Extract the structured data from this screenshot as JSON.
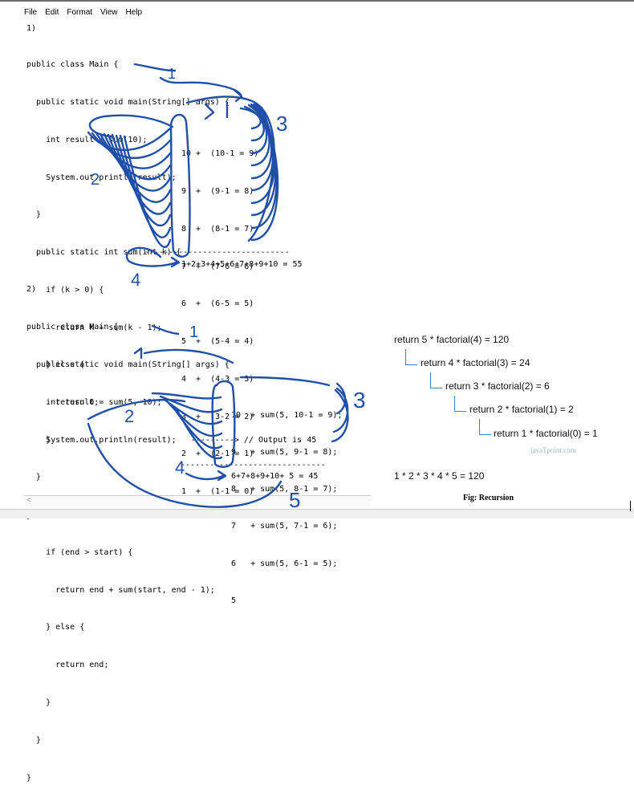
{
  "menu": [
    "File",
    "Edit",
    "Format",
    "View",
    "Help"
  ],
  "example1": {
    "label": "1)",
    "code": [
      "public class Main {",
      "  public static void main(String[] args) {",
      "    int result = sum(10);",
      "    System.out.println(result);",
      "  }",
      "  public static int sum(int k) {",
      "    if (k > 0) {",
      "      return k + sum(k - 1);",
      "    } else {",
      "      return 0;",
      "    }",
      "",
      "}"
    ],
    "trace": [
      "10 +  (10-1 = 9)",
      "9  +  (9-1 = 8)",
      "8  +  (8-1 = 7)",
      "7  +  (7-6 = 6)",
      "6  +  (6-5 = 5)",
      "5  +  (5-4 = 4)",
      "4  +  (4-3 = 3)",
      "3  +  (3-2 = 2)",
      "2  +  (2-1 = 1)",
      "1  +  (1-1 = 0)"
    ],
    "divider": "------------------------------",
    "result": "1+2+3+4+5+6+7+8+9+10 = 55",
    "annotations": [
      "1",
      "2",
      "3",
      "4"
    ]
  },
  "example2": {
    "label": "2)",
    "code": [
      "public class Main {",
      "  public static void main(String[] args) {",
      "    int result = sum(5, 10);",
      "    System.out.println(result);   ---------> // Output is 45",
      "  }",
      "  public static int sum(int start, int end) {",
      "    if (end > start) {",
      "      return end + sum(start, end - 1);",
      "    } else {",
      "      return end;",
      "    }",
      "  }",
      "}"
    ],
    "trace": [
      "10  + sum(5, 10-1 = 9);",
      "9   + sum(5, 9-1 = 8);",
      "8   + sum(5, 8-1 = 7);",
      "7   + sum(5, 7-1 = 6);",
      "6   + sum(5, 6-1 = 5);",
      "5"
    ],
    "divider": "------------------------------",
    "result": "6+7+8+9+10+ 5 = 45",
    "annotations": [
      "1",
      "2",
      "3",
      "4",
      "5"
    ]
  },
  "factorial": {
    "lines": [
      "return 5 * factorial(4) = 120",
      "return 4 * factorial(3) = 24",
      "return 3 * factorial(2) = 6",
      "return 2 * factorial(1) = 2",
      "return 1 * factorial(0) = 1"
    ],
    "product": "1 * 2 * 3 * 4 * 5 = 120",
    "watermark": "javaTpoint.com",
    "caption": "Fig: Recursion",
    "connector_color": "#3b83c4"
  },
  "scroll_left": "<",
  "ink_color": "#1f4fa8"
}
